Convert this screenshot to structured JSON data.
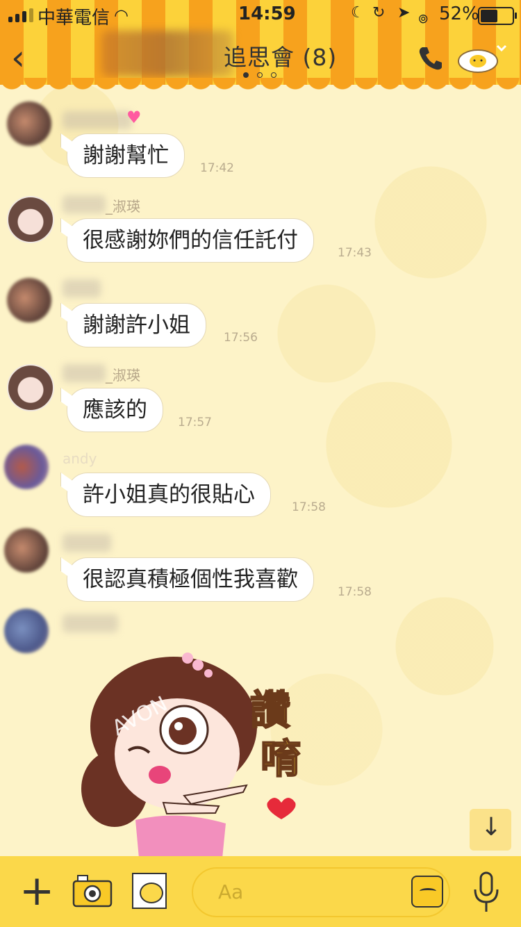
{
  "status_bar": {
    "carrier": "中華電信",
    "time": "14:59",
    "battery_percent": "52%"
  },
  "header": {
    "chat_title": "追思會 (8)",
    "page_count": 3,
    "active_page": 1
  },
  "messages": [
    {
      "sender": "",
      "text": "謝謝幫忙",
      "time": "17:42"
    },
    {
      "sender": "_淑瑛",
      "text": "很感謝妳們的信任託付",
      "time": "17:43"
    },
    {
      "sender": "",
      "text": "謝謝許小姐",
      "time": "17:56"
    },
    {
      "sender": "_淑瑛",
      "text": "應該的",
      "time": "17:57"
    },
    {
      "sender": "andy",
      "text": "許小姐真的很貼心",
      "time": "17:58"
    },
    {
      "sender": "",
      "text": "很認真積極個性我喜歡",
      "time": "17:58"
    }
  ],
  "sticker": {
    "brand": "AVON",
    "text_line1": "讚",
    "text_line2": "唷"
  },
  "input_bar": {
    "placeholder": "Aa"
  },
  "colors": {
    "header_orange": "#f7a21d",
    "header_yellow": "#fcd23a",
    "background": "#fdf3c8",
    "input_bar": "#fbd84a"
  }
}
